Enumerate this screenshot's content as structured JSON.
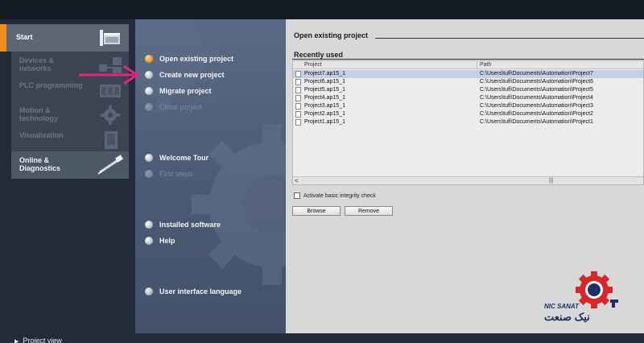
{
  "portal": {
    "start": "Start",
    "items": [
      {
        "label": "Devices & networks",
        "enabled": false
      },
      {
        "label": "PLC programming",
        "enabled": false
      },
      {
        "label": "Motion & technology",
        "enabled": false
      },
      {
        "label": "Visualization",
        "enabled": false
      },
      {
        "label": "Online & Diagnostics",
        "enabled": true
      }
    ],
    "project_view": "Project view"
  },
  "actions": [
    {
      "label": "Open existing project",
      "state": "active"
    },
    {
      "label": "Create new project",
      "state": "normal"
    },
    {
      "label": "Migrate project",
      "state": "normal"
    },
    {
      "label": "Close project",
      "state": "disabled"
    },
    {
      "label": "Welcome Tour",
      "state": "normal"
    },
    {
      "label": "First steps",
      "state": "disabled"
    },
    {
      "label": "Installed software",
      "state": "normal"
    },
    {
      "label": "Help",
      "state": "normal"
    },
    {
      "label": "User interface language",
      "state": "normal"
    }
  ],
  "pane": {
    "title": "Open existing project",
    "recent_heading": "Recently used",
    "columns": [
      "Project",
      "Path"
    ],
    "rows": [
      {
        "project": "Project7.ap15_1",
        "path": "C:\\Users\\tufi\\Documents\\Automation\\Project7",
        "selected": true
      },
      {
        "project": "Project6.ap15_1",
        "path": "C:\\Users\\tufi\\Documents\\Automation\\Project6",
        "selected": false
      },
      {
        "project": "Project5.ap15_1",
        "path": "C:\\Users\\tufi\\Documents\\Automation\\Project5",
        "selected": false
      },
      {
        "project": "Project4.ap15_1",
        "path": "C:\\Users\\tufi\\Documents\\Automation\\Project4",
        "selected": false
      },
      {
        "project": "Project3.ap15_1",
        "path": "C:\\Users\\tufi\\Documents\\Automation\\Project3",
        "selected": false
      },
      {
        "project": "Project2.ap15_1",
        "path": "C:\\Users\\tufi\\Documents\\Automation\\Project2",
        "selected": false
      },
      {
        "project": "Project1.ap15_1",
        "path": "C:\\Users\\tufi\\Documents\\Automation\\Project1",
        "selected": false
      }
    ],
    "integrity_check": "Activate basic integrity check",
    "browse": "Browse",
    "remove": "Remove"
  },
  "logo": {
    "brand": "NIC SANAT",
    "persian": "نیک صنعت"
  },
  "colors": {
    "accent": "#f28c1c",
    "annotation_arrow": "#e0287a",
    "logo_red": "#d8262b",
    "logo_blue": "#1f2f66"
  }
}
